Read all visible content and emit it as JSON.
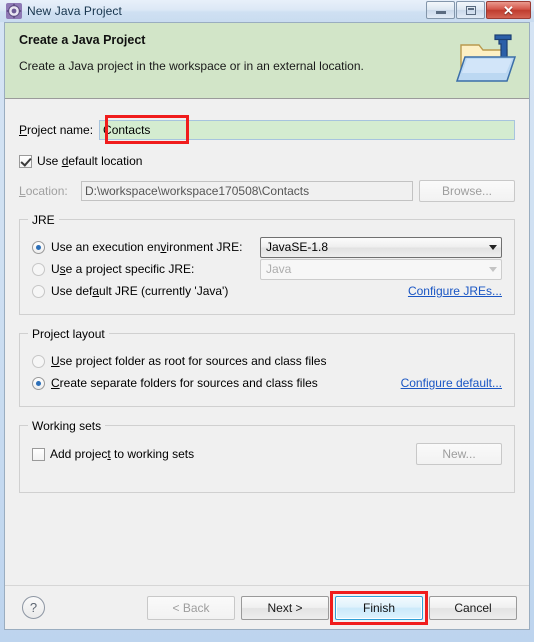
{
  "window": {
    "title": "New Java Project",
    "icon": "eclipse-wizard-icon",
    "controls": {
      "minimize": "minimize-icon",
      "maximize": "maximize-icon",
      "close": "close-icon",
      "close_glyph": "✕"
    }
  },
  "banner": {
    "title": "Create a Java Project",
    "description": "Create a Java project in the workspace or in an external location.",
    "graphic": "java-project-folder-icon",
    "background_color": "#d2e5c8"
  },
  "form": {
    "project_name": {
      "label": "Project name:",
      "label_mnemonic": "P",
      "value": "Contacts",
      "placeholder": "",
      "valid_background": "#d4ecd0"
    },
    "use_default_location": {
      "label": "Use default location",
      "checked": true
    },
    "location": {
      "label": "Location:",
      "value": "D:\\workspace\\workspace170508\\Contacts",
      "enabled": false,
      "browse_label": "Browse..."
    }
  },
  "jre_group": {
    "title": "JRE",
    "options": [
      {
        "label": "Use an execution environment JRE:",
        "selected": true,
        "control": "combo",
        "value": "JavaSE-1.8",
        "enabled": true
      },
      {
        "label": "Use a project specific JRE:",
        "selected": false,
        "control": "combo",
        "value": "Java",
        "enabled": false
      },
      {
        "label": "Use default JRE (currently 'Java')",
        "selected": false,
        "control": "none",
        "value": "",
        "enabled": true
      }
    ],
    "link": "Configure JREs..."
  },
  "layout_group": {
    "title": "Project layout",
    "options": [
      {
        "label": "Use project folder as root for sources and class files",
        "selected": false
      },
      {
        "label": "Create separate folders for sources and class files",
        "selected": true
      }
    ],
    "link": "Configure default..."
  },
  "working_sets_group": {
    "title": "Working sets",
    "checkbox": {
      "label": "Add project to working sets",
      "checked": false
    },
    "new_button": "New..."
  },
  "buttonbar": {
    "help": "?",
    "back": "< Back",
    "back_enabled": false,
    "next": "Next >",
    "finish": "Finish",
    "cancel": "Cancel",
    "default_button": "finish"
  },
  "annotations": {
    "color": "#f01c1c",
    "targets": [
      "project-name-field",
      "finish-button"
    ]
  }
}
